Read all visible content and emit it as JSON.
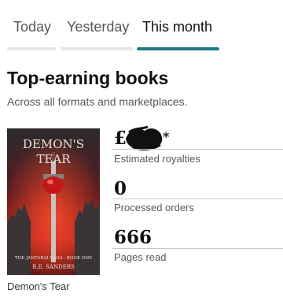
{
  "tabs": [
    {
      "label": "Today",
      "active": false
    },
    {
      "label": "Yesterday",
      "active": false
    },
    {
      "label": "This month",
      "active": true
    }
  ],
  "accent_color": "#1e7b85",
  "section": {
    "title": "Top-earning books",
    "subtitle": "Across all formats and marketplaces."
  },
  "book": {
    "title": "Demon's Tear",
    "cover": {
      "title_line1": "DEMON'S",
      "title_line2": "TEAR",
      "series": "THE JANTARAI SAGA · BOOK ONE",
      "author": "R.E. SANDERS"
    }
  },
  "metrics": {
    "royalties": {
      "currency": "£",
      "value_redacted": true,
      "suffix": "*",
      "label": "Estimated royalties"
    },
    "orders": {
      "value": "0",
      "label": "Processed orders"
    },
    "pages": {
      "value": "666",
      "label": "Pages read"
    }
  }
}
